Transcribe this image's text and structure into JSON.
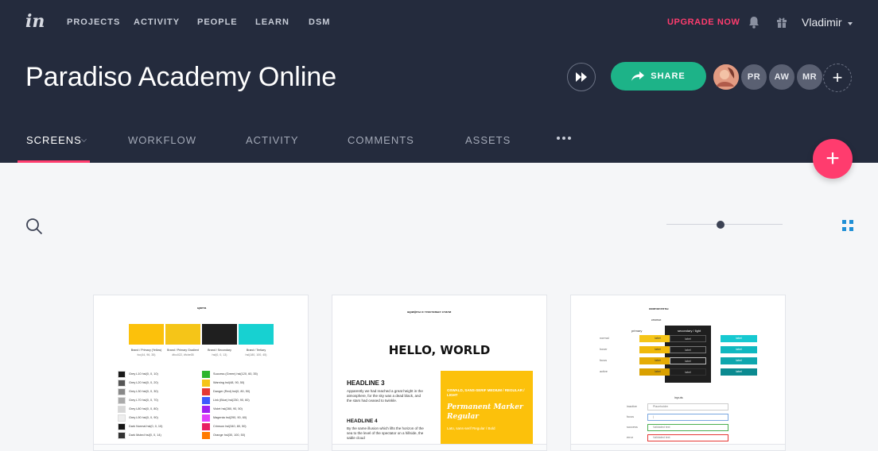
{
  "nav": {
    "items": [
      "PROJECTS",
      "ACTIVITY",
      "PEOPLE",
      "LEARN",
      "DSM"
    ],
    "upgrade": "UPGRADE NOW",
    "user": "Vladimir"
  },
  "project": {
    "title": "Paradiso Academy Online",
    "share_label": "SHARE",
    "avatars": [
      "PR",
      "AW",
      "MR"
    ],
    "add_label": "+"
  },
  "tabs": [
    "SCREENS",
    "WORKFLOW",
    "ACTIVITY",
    "COMMENTS",
    "ASSETS"
  ],
  "fab_label": "+",
  "colors": {
    "accent": "#ff3c6e",
    "share": "#1db388",
    "header": "#242b3d",
    "grid_icon": "#1f8fd6"
  },
  "cards": {
    "c1": {
      "heading": "цвета",
      "brand": [
        {
          "color": "#fcc10b",
          "name": "Brand / Primary (Yellow)",
          "code": "fcc(44, 96, 35)"
        },
        {
          "color": "#f5c518",
          "name": "Brand / Primary Gradient",
          "code": "#fcc022, #fcbe05"
        },
        {
          "color": "#1f1f1f",
          "name": "Brand / Secondary",
          "code": "hsl(0, 0, 13)"
        },
        {
          "color": "#17d1d1",
          "name": "Brand / Tertiary",
          "code": "hsl(180, 100, 45)"
        }
      ],
      "greys": [
        {
          "color": "#1a1a1a",
          "name": "Grey L10 hsl(0, 0, 10)"
        },
        {
          "color": "#555555",
          "name": "Grey L20 hsl(0, 0, 20)"
        },
        {
          "color": "#888888",
          "name": "Grey L30 hsl(0, 0, 30)"
        },
        {
          "color": "#aaaaaa",
          "name": "Grey L70 hsl(0, 0, 70)"
        },
        {
          "color": "#d8d8d8",
          "name": "Grey L80 hsl(0, 0, 80)"
        },
        {
          "color": "#eeeeee",
          "name": "Grey L90 hsl(0, 0, 90)"
        },
        {
          "color": "#161616",
          "name": "Dark Normal hsl(0, 0, 10)"
        },
        {
          "color": "#333333",
          "name": "Dark Muted hsl(0, 0, 14)"
        }
      ],
      "states": [
        {
          "color": "#2db52d",
          "name": "Success (Green) hsl(120, 60, 35)"
        },
        {
          "color": "#f5c518",
          "name": "Warning hsl(48, 90, 50)"
        },
        {
          "color": "#e53935",
          "name": "Danger (Red) hsl(0, 80, 50)"
        },
        {
          "color": "#3d5afe",
          "name": "Link (Blue) hsl(230, 90, 60)"
        },
        {
          "color": "#a020f0",
          "name": "Violet hsl(280, 90, 50)"
        },
        {
          "color": "#e040fb",
          "name": "Magenta hsl(290, 90, 60)"
        },
        {
          "color": "#e91e63",
          "name": "Crimson hsl(340, 80, 50)"
        },
        {
          "color": "#ff7a00",
          "name": "Orange hsl(30, 100, 50)"
        }
      ]
    },
    "c2": {
      "heading": "шрифты и текстовые стили",
      "hello": "HELLO, WORLD",
      "h3": "HEADLINE 3",
      "h3_text": "Apparently we had reached a great height in the atmosphere, for the sky was a dead black, and the stars had ceased to twinkle.",
      "h4": "HEADLINE 4",
      "h4_text": "By the same illusion which lifts the horizon of the sea to the level of the spectator on a hillside, the sable cloud",
      "panel_title": "OSWALD, SANS-SERIF MEDIUM / REGULAR / LIGHT",
      "panel_script": "Permanent Marker Regular",
      "panel_sub": "Lato, sans-serif Regular / Bold"
    },
    "c3": {
      "heading": "компоненты",
      "sub": "кнопки",
      "col1": "primary",
      "col2": "secondary / light",
      "rows": [
        "normal",
        "hover",
        "focus",
        "active"
      ],
      "btn_label": "label",
      "inputs_title": "inputs",
      "input_rows": [
        "inactive",
        "focus",
        "success",
        "error"
      ],
      "input_values": [
        "Placeholder",
        "|",
        "Validated text",
        "Validated text"
      ]
    }
  }
}
